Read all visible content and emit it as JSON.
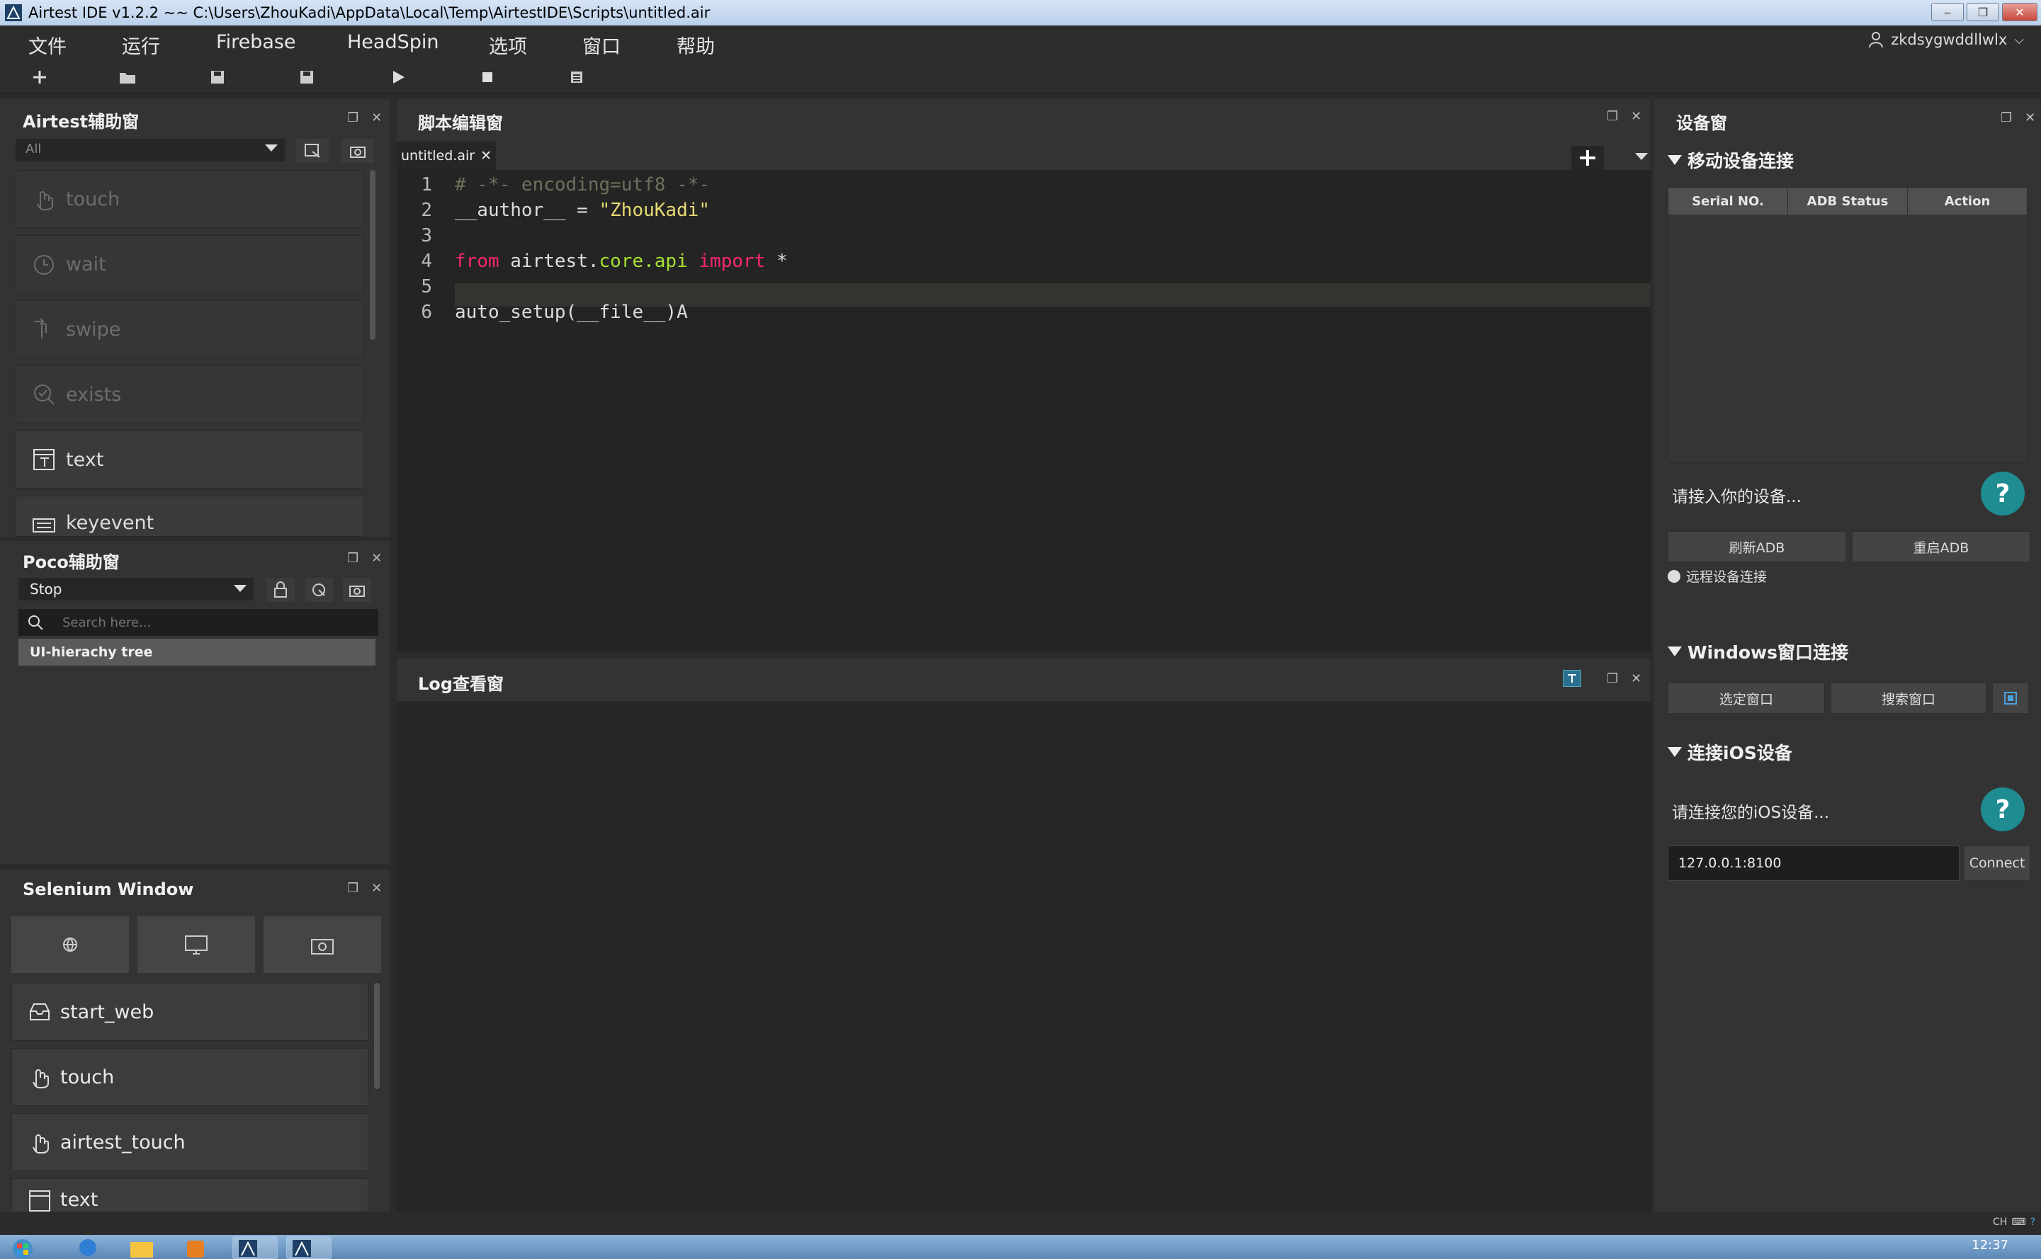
{
  "window": {
    "title": "Airtest IDE v1.2.2 ~~ C:\\Users\\ZhouKadi\\AppData\\Local\\Temp\\AirtestIDE\\Scripts\\untitled.air"
  },
  "menu": {
    "items": [
      "文件",
      "运行",
      "Firebase",
      "HeadSpin",
      "选项",
      "窗口",
      "帮助"
    ],
    "user": "zkdsygwddllwlx"
  },
  "airtest_panel": {
    "title": "Airtest辅助窗",
    "filter": "All",
    "commands": [
      {
        "label": "touch",
        "enabled": false,
        "icon": "hand-icon"
      },
      {
        "label": "wait",
        "enabled": false,
        "icon": "clock-icon"
      },
      {
        "label": "swipe",
        "enabled": false,
        "icon": "swipe-icon"
      },
      {
        "label": "exists",
        "enabled": false,
        "icon": "check-search-icon"
      },
      {
        "label": "text",
        "enabled": true,
        "icon": "text-icon"
      },
      {
        "label": "keyevent",
        "enabled": true,
        "icon": "keyboard-icon"
      }
    ]
  },
  "poco_panel": {
    "title": "Poco辅助窗",
    "mode": "Stop",
    "search_placeholder": "Search here...",
    "tree_root": "UI-hierachy tree"
  },
  "selenium_panel": {
    "title": "Selenium Window",
    "commands": [
      {
        "label": "start_web",
        "icon": "inbox-icon"
      },
      {
        "label": "touch",
        "icon": "hand-icon"
      },
      {
        "label": "airtest_touch",
        "icon": "hand-icon"
      },
      {
        "label": "text",
        "icon": "text-icon"
      }
    ]
  },
  "editor": {
    "title": "脚本编辑窗",
    "tab": "untitled.air",
    "lines": [
      {
        "n": "1",
        "parts": [
          {
            "t": "# -*- encoding=utf8 -*-",
            "c": "comment"
          }
        ]
      },
      {
        "n": "2",
        "parts": [
          {
            "t": "__author__ = ",
            "c": "plain"
          },
          {
            "t": "\"ZhouKadi\"",
            "c": "str"
          }
        ]
      },
      {
        "n": "3",
        "parts": []
      },
      {
        "n": "4",
        "parts": [
          {
            "t": "from",
            "c": "kw"
          },
          {
            "t": " airtest.",
            "c": "plain"
          },
          {
            "t": "core.api",
            "c": "mod"
          },
          {
            "t": " ",
            "c": "plain"
          },
          {
            "t": "import",
            "c": "kw"
          },
          {
            "t": " *",
            "c": "plain"
          }
        ]
      },
      {
        "n": "5",
        "parts": []
      },
      {
        "n": "6",
        "parts": [
          {
            "t": "auto_setup(__file__)A",
            "c": "plain"
          }
        ]
      }
    ]
  },
  "log_panel": {
    "title": "Log查看窗"
  },
  "device_panel": {
    "title": "设备窗",
    "mobile_section": "移动设备连接",
    "columns": [
      "Serial NO.",
      "ADB Status",
      "Action"
    ],
    "connect_hint": "请接入你的设备...",
    "refresh_adb": "刷新ADB",
    "restart_adb": "重启ADB",
    "remote_connect": "远程设备连接",
    "windows_section": "Windows窗口连接",
    "select_window": "选定窗口",
    "search_window": "搜索窗口",
    "ios_section": "连接iOS设备",
    "ios_hint": "请连接您的iOS设备...",
    "ios_address": "127.0.0.1:8100",
    "connect": "Connect",
    "help_mark": "?"
  },
  "taskbar": {
    "time": "12:37",
    "lang": "CH"
  },
  "colors": {
    "accent": "#1f8c91",
    "background": "#2b2b2b",
    "panel": "#333333"
  }
}
